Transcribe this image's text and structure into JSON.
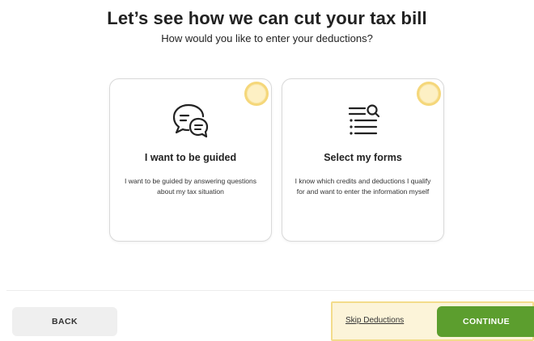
{
  "header": {
    "title": "Let’s see how we can cut your tax bill",
    "subtitle": "How would you like to enter your deductions?"
  },
  "options": [
    {
      "icon": "chat-bubbles-icon",
      "title": "I want to be guided",
      "description": "I want to be guided by answering questions about my tax situation"
    },
    {
      "icon": "list-search-icon",
      "title": "Select my forms",
      "description": "I know which credits and deductions I qualify for and want to enter the information myself"
    }
  ],
  "footer": {
    "back_label": "BACK",
    "skip_label": "Skip Deductions",
    "continue_label": "CONTINUE"
  },
  "colors": {
    "continue_green": "#5c9e2e",
    "highlight_yellow": "#fcf4d9",
    "radio_yellow": "#f5d77a",
    "back_gray": "#efefef"
  }
}
